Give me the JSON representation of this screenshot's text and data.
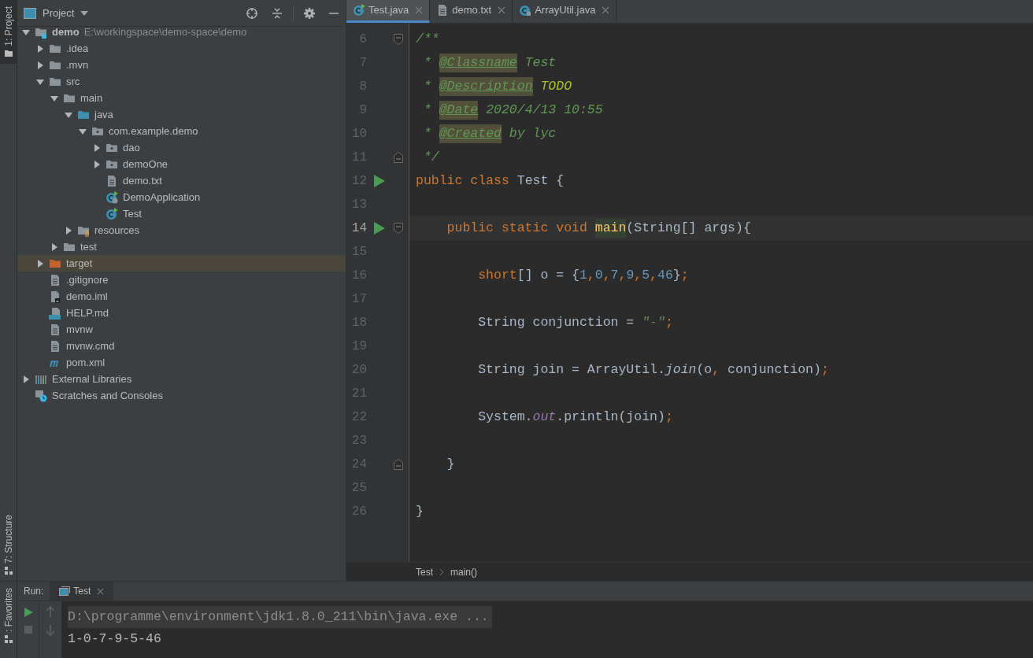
{
  "side_stripe": {
    "top": [
      {
        "label": "1: Project",
        "selected": true
      }
    ],
    "bottom": [
      {
        "label": "7: Structure",
        "selected": false
      },
      {
        "label": ": Favorites",
        "selected": false
      }
    ]
  },
  "project": {
    "title": "Project",
    "tree": [
      {
        "label": "demo",
        "hint": "E:\\workingspace\\demo-space\\demo",
        "kind": "module",
        "expanded": true,
        "selected": false,
        "children": [
          {
            "label": ".idea",
            "kind": "folder",
            "expanded": false,
            "selected": false
          },
          {
            "label": ".mvn",
            "kind": "folder",
            "expanded": false,
            "selected": false
          },
          {
            "label": "src",
            "kind": "folder",
            "expanded": true,
            "selected": false,
            "children": [
              {
                "label": "main",
                "kind": "folder",
                "expanded": true,
                "selected": false,
                "children": [
                  {
                    "label": "java",
                    "kind": "source",
                    "expanded": true,
                    "selected": false,
                    "children": [
                      {
                        "label": "com.example.demo",
                        "kind": "package",
                        "expanded": true,
                        "selected": false,
                        "children": [
                          {
                            "label": "dao",
                            "kind": "package",
                            "expanded": false,
                            "selected": false
                          },
                          {
                            "label": "demoOne",
                            "kind": "package",
                            "expanded": false,
                            "selected": false
                          },
                          {
                            "label": "demo.txt",
                            "kind": "text",
                            "selected": false
                          },
                          {
                            "label": "DemoApplication",
                            "kind": "spring-class",
                            "selected": false
                          },
                          {
                            "label": "Test",
                            "kind": "run-class",
                            "selected": false
                          }
                        ]
                      }
                    ]
                  },
                  {
                    "label": "resources",
                    "kind": "resources",
                    "expanded": false,
                    "selected": false
                  }
                ]
              },
              {
                "label": "test",
                "kind": "folder",
                "expanded": false,
                "selected": false
              }
            ]
          },
          {
            "label": "target",
            "kind": "excluded",
            "expanded": false,
            "selected": true
          },
          {
            "label": ".gitignore",
            "kind": "text",
            "selected": false
          },
          {
            "label": "demo.iml",
            "kind": "iml",
            "selected": false
          },
          {
            "label": "HELP.md",
            "kind": "markdown",
            "selected": false
          },
          {
            "label": "mvnw",
            "kind": "text",
            "selected": false
          },
          {
            "label": "mvnw.cmd",
            "kind": "text",
            "selected": false
          },
          {
            "label": "pom.xml",
            "kind": "maven",
            "selected": false
          }
        ]
      },
      {
        "label": "External Libraries",
        "kind": "libraries",
        "expanded": false,
        "selected": false
      },
      {
        "label": "Scratches and Consoles",
        "kind": "scratches",
        "selected": false
      }
    ]
  },
  "editor": {
    "tabs": [
      {
        "label": "Test.java",
        "kind": "run-class",
        "selected": true
      },
      {
        "label": "demo.txt",
        "kind": "text",
        "selected": false
      },
      {
        "label": "ArrayUtil.java",
        "kind": "locked-class",
        "selected": false
      }
    ],
    "lines": [
      {
        "number": "6",
        "run": false,
        "fold_start": true,
        "fold_end": false,
        "current": false,
        "tokens": [
          {
            "kind": "comment",
            "text": "/**"
          }
        ]
      },
      {
        "number": "7",
        "run": false,
        "fold_start": false,
        "fold_end": false,
        "current": false,
        "tokens": [
          {
            "kind": "comment",
            "text": " * "
          },
          {
            "kind": "tag",
            "text": "@Classname"
          },
          {
            "kind": "comment",
            "text": " Test"
          }
        ]
      },
      {
        "number": "8",
        "run": false,
        "fold_start": false,
        "fold_end": false,
        "current": false,
        "tokens": [
          {
            "kind": "comment",
            "text": " * "
          },
          {
            "kind": "tag",
            "text": "@Description"
          },
          {
            "kind": "todo",
            "text": " TODO"
          }
        ]
      },
      {
        "number": "9",
        "run": false,
        "fold_start": false,
        "fold_end": false,
        "current": false,
        "tokens": [
          {
            "kind": "comment",
            "text": " * "
          },
          {
            "kind": "tag",
            "text": "@Date"
          },
          {
            "kind": "comment",
            "text": " 2020/4/13 10:55"
          }
        ]
      },
      {
        "number": "10",
        "run": false,
        "fold_start": false,
        "fold_end": false,
        "current": false,
        "tokens": [
          {
            "kind": "comment",
            "text": " * "
          },
          {
            "kind": "tag",
            "text": "@Created"
          },
          {
            "kind": "comment",
            "text": " by lyc"
          }
        ]
      },
      {
        "number": "11",
        "run": false,
        "fold_start": false,
        "fold_end": true,
        "current": false,
        "tokens": [
          {
            "kind": "comment",
            "text": " */"
          }
        ]
      },
      {
        "number": "12",
        "run": true,
        "fold_start": false,
        "fold_end": false,
        "current": false,
        "tokens": [
          {
            "kind": "keyword",
            "text": "public class "
          },
          {
            "kind": "plain",
            "text": "Test {"
          }
        ]
      },
      {
        "number": "13",
        "run": false,
        "fold_start": false,
        "fold_end": false,
        "current": false
      },
      {
        "number": "14",
        "run": true,
        "fold_start": true,
        "fold_end": false,
        "current": true,
        "tokens": [
          {
            "kind": "keyword",
            "text": "    public static void "
          },
          {
            "kind": "declaration",
            "text": "main"
          },
          {
            "kind": "plain",
            "text": "(String[] args){"
          }
        ]
      },
      {
        "number": "15",
        "run": false,
        "fold_start": false,
        "fold_end": false,
        "current": false
      },
      {
        "number": "16",
        "run": false,
        "fold_start": false,
        "fold_end": false,
        "current": false,
        "tokens": [
          {
            "kind": "keyword",
            "text": "        short"
          },
          {
            "kind": "plain",
            "text": "[] o = {"
          },
          {
            "kind": "number",
            "text": "1"
          },
          {
            "kind": "punct",
            "text": ","
          },
          {
            "kind": "number",
            "text": "0"
          },
          {
            "kind": "punct",
            "text": ","
          },
          {
            "kind": "number",
            "text": "7"
          },
          {
            "kind": "punct",
            "text": ","
          },
          {
            "kind": "number",
            "text": "9"
          },
          {
            "kind": "punct",
            "text": ","
          },
          {
            "kind": "number",
            "text": "5"
          },
          {
            "kind": "punct",
            "text": ","
          },
          {
            "kind": "number",
            "text": "46"
          },
          {
            "kind": "plain",
            "text": "}"
          },
          {
            "kind": "punct",
            "text": ";"
          }
        ]
      },
      {
        "number": "17",
        "run": false,
        "fold_start": false,
        "fold_end": false,
        "current": false
      },
      {
        "number": "18",
        "run": false,
        "fold_start": false,
        "fold_end": false,
        "current": false,
        "tokens": [
          {
            "kind": "plain",
            "text": "        String conjunction = "
          },
          {
            "kind": "string",
            "text": "\"-\""
          },
          {
            "kind": "punct",
            "text": ";"
          }
        ]
      },
      {
        "number": "19",
        "run": false,
        "fold_start": false,
        "fold_end": false,
        "current": false
      },
      {
        "number": "20",
        "run": false,
        "fold_start": false,
        "fold_end": false,
        "current": false,
        "tokens": [
          {
            "kind": "plain",
            "text": "        String join = ArrayUtil."
          },
          {
            "kind": "static-method",
            "text": "join"
          },
          {
            "kind": "plain",
            "text": "(o"
          },
          {
            "kind": "punct",
            "text": ", "
          },
          {
            "kind": "plain",
            "text": "conjunction)"
          },
          {
            "kind": "punct",
            "text": ";"
          }
        ]
      },
      {
        "number": "21",
        "run": false,
        "fold_start": false,
        "fold_end": false,
        "current": false
      },
      {
        "number": "22",
        "run": false,
        "fold_start": false,
        "fold_end": false,
        "current": false,
        "tokens": [
          {
            "kind": "plain",
            "text": "        System."
          },
          {
            "kind": "static-field",
            "text": "out"
          },
          {
            "kind": "plain",
            "text": ".println(join)"
          },
          {
            "kind": "punct",
            "text": ";"
          }
        ]
      },
      {
        "number": "23",
        "run": false,
        "fold_start": false,
        "fold_end": false,
        "current": false
      },
      {
        "number": "24",
        "run": false,
        "fold_start": false,
        "fold_end": true,
        "current": false,
        "tokens": [
          {
            "kind": "plain",
            "text": "    }"
          }
        ]
      },
      {
        "number": "25",
        "run": false,
        "fold_start": false,
        "fold_end": false,
        "current": false
      },
      {
        "number": "26",
        "run": false,
        "fold_start": false,
        "fold_end": false,
        "current": false,
        "tokens": [
          {
            "kind": "plain",
            "text": "}"
          }
        ]
      }
    ],
    "breadcrumbs": [
      "Test",
      "main()"
    ]
  },
  "run_panel": {
    "label": "Run:",
    "tabs": [
      {
        "label": "Test",
        "selected": true
      }
    ],
    "output": [
      {
        "kind": "command",
        "text": "D:\\programme\\environment\\jdk1.8.0_211\\bin\\java.exe ..."
      },
      {
        "kind": "output",
        "text": "1-0-7-9-5-46"
      }
    ]
  }
}
